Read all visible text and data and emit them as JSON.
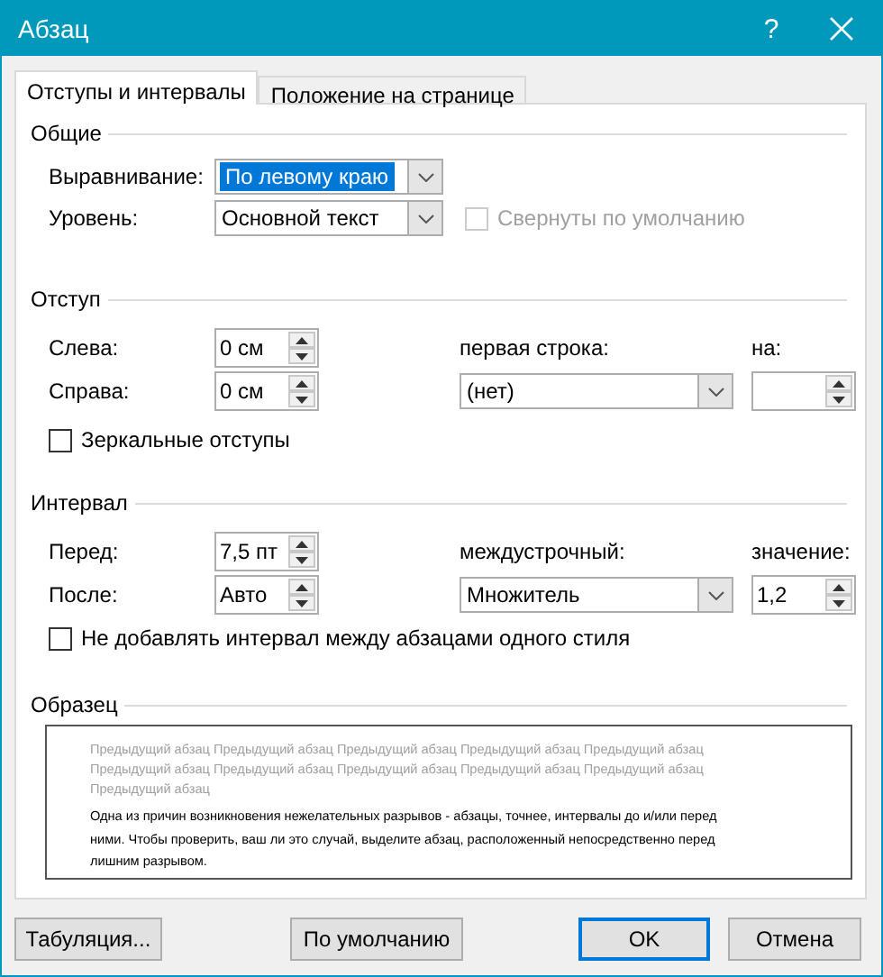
{
  "window": {
    "title": "Абзац",
    "help_glyph": "?"
  },
  "tabs": [
    {
      "label": "Отступы и интервалы",
      "selected": true
    },
    {
      "label": "Положение на странице",
      "selected": false
    }
  ],
  "general": {
    "title": "Общие",
    "alignment": {
      "label": "Выравнивание:",
      "value": "По левому краю",
      "highlighted": true
    },
    "level": {
      "label": "Уровень:",
      "value": "Основной текст",
      "highlighted": false
    },
    "collapsed": {
      "label": "Свернуты по умолчанию",
      "checked": false,
      "disabled": true
    }
  },
  "indent": {
    "title": "Отступ",
    "left": {
      "label": "Слева:",
      "value": "0 см"
    },
    "right": {
      "label": "Справа:",
      "value": "0 см"
    },
    "first_line": {
      "label": "первая строка:",
      "value": "(нет)",
      "highlighted": false
    },
    "by": {
      "label": "на:"
    },
    "mirror": {
      "label": "Зеркальные отступы",
      "checked": false,
      "disabled": false
    }
  },
  "spacing": {
    "title": "Интервал",
    "before": {
      "label": "Перед:",
      "value": "7,5 пт"
    },
    "after": {
      "label": "После:",
      "value": "Авто"
    },
    "line_spacing": {
      "label": "междустрочный:",
      "value": "Множитель",
      "highlighted": false
    },
    "at": {
      "label": "значение:",
      "value": "1,2"
    },
    "dont_add": {
      "label": "Не добавлять интервал между абзацами одного стиля",
      "checked": false,
      "disabled": false
    }
  },
  "preview": {
    "title": "Образец",
    "previous_text": "Предыдущий абзац Предыдущий абзац Предыдущий абзац Предыдущий абзац Предыдущий абзац Предыдущий абзац Предыдущий абзац Предыдущий абзац Предыдущий абзац Предыдущий абзац Предыдущий абзац",
    "sample_text": "Одна из причин возникновения нежелательных разрывов - абзацы, точнее, интервалы до и/или перед ними. Чтобы проверить, ваш ли это случай, выделите абзац, расположенный непосредственно перед лишним разрывом."
  },
  "buttons": [
    {
      "label": "Табуляция...",
      "default": false
    },
    {
      "label": "По умолчанию",
      "default": false
    },
    {
      "label": "OK",
      "default": true
    },
    {
      "label": "Отмена",
      "default": false
    }
  ]
}
